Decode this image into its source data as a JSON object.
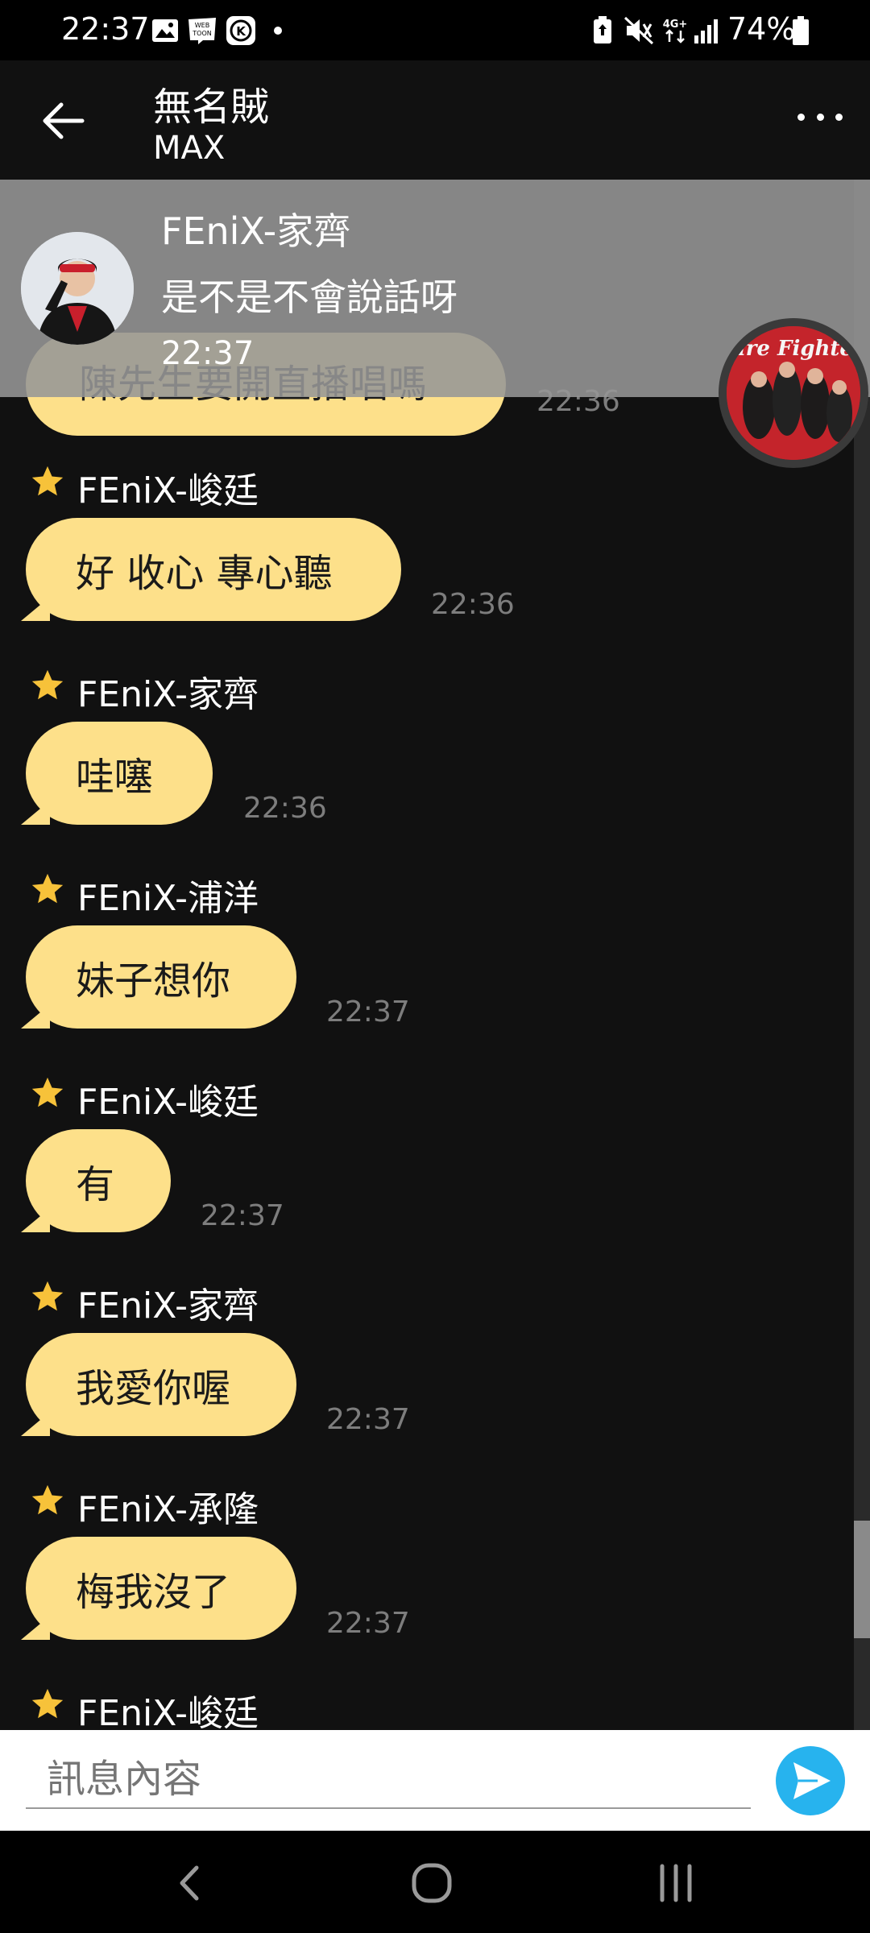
{
  "status_bar": {
    "time": "22:37",
    "battery_percent": "74%",
    "network_type": "4G+",
    "icons": [
      "gallery-icon",
      "webtoon-icon",
      "k-app-icon",
      "dot-icon",
      "battery-saver-icon",
      "mute-icon",
      "network-icon",
      "signal-icon",
      "battery-icon"
    ]
  },
  "header": {
    "title": "無名賊",
    "subtitle": "MAX"
  },
  "notification": {
    "sender": "FEniX-家齊",
    "text": "是不是不會說話呀",
    "time": "22:37"
  },
  "partial_message": {
    "text": "陳先生要開直播唱嗎",
    "time": "22:36"
  },
  "messages": [
    {
      "sender": "FEniX-峻廷",
      "text": "好 收心 專心聽",
      "time": "22:36"
    },
    {
      "sender": "FEniX-家齊",
      "text": "哇噻",
      "time": "22:36"
    },
    {
      "sender": "FEniX-浦洋",
      "text": "妹子想你",
      "time": "22:37"
    },
    {
      "sender": "FEniX-峻廷",
      "text": "有",
      "time": "22:37"
    },
    {
      "sender": "FEniX-家齊",
      "text": "我愛你喔",
      "time": "22:37"
    },
    {
      "sender": "FEniX-承隆",
      "text": "梅我沒了",
      "time": "22:37"
    },
    {
      "sender": "FEniX-峻廷"
    }
  ],
  "floating_bubble": {
    "logo_text": "Fire Fighter"
  },
  "input": {
    "placeholder": "訊息內容"
  },
  "colors": {
    "bubble": "#fde08a",
    "star": "#f7c23a",
    "send": "#27b3ee",
    "background": "#111111"
  }
}
